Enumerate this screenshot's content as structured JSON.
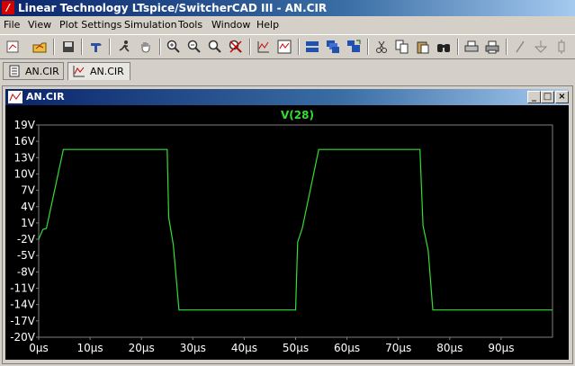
{
  "window": {
    "title": "Linear Technology LTspice/SwitcherCAD III - AN.CIR",
    "app_icon_letter": "/"
  },
  "menu": [
    "File",
    "View",
    "Plot Settings",
    "Simulation",
    "Tools",
    "Window",
    "Help"
  ],
  "toolbar": {
    "icons": [
      "open-schematic-icon",
      "new-schematic-icon",
      "save-icon",
      "hammer-icon",
      "run-icon",
      "hand-pan-icon",
      "zoom-in-icon",
      "zoom-out-icon",
      "zoom-fit-icon",
      "cancel-zoom-icon",
      "autorange-icon",
      "trace-icon",
      "tile-icon",
      "cascade-icon",
      "arrange-icon",
      "cut-icon",
      "copy-icon",
      "find-icon",
      "print-setup-icon",
      "print-icon",
      "draw-line-icon",
      "ground-icon",
      "resistor-icon"
    ]
  },
  "tabs": [
    {
      "label": "AN.CIR",
      "kind": "netlist",
      "active": false
    },
    {
      "label": "AN.CIR",
      "kind": "waveform",
      "active": true
    }
  ],
  "child_window": {
    "title": "AN.CIR",
    "buttons": {
      "minimize": "_",
      "maximize": "□",
      "close": "×"
    }
  },
  "colors": {
    "trace": "#33dd33",
    "plot_bg": "#000000",
    "axis_text": "#ffffff",
    "grid_frame": "#808080"
  },
  "chart_data": {
    "type": "line",
    "title": "V(28)",
    "xlabel": "",
    "ylabel": "",
    "x_ticks": [
      "0µs",
      "10µs",
      "20µs",
      "30µs",
      "40µs",
      "50µs",
      "60µs",
      "70µs",
      "80µs",
      "90µs"
    ],
    "y_ticks": [
      "19V",
      "16V",
      "13V",
      "10V",
      "7V",
      "4V",
      "1V",
      "-2V",
      "-5V",
      "-8V",
      "-11V",
      "-14V",
      "-17V",
      "-20V"
    ],
    "xlim": [
      0,
      100
    ],
    "ylim": [
      -20,
      19
    ],
    "grid": false,
    "series": [
      {
        "name": "V(28)",
        "x": [
          0,
          0.8,
          1.5,
          4.8,
          25.0,
          25.3,
          26.2,
          27.3,
          50.0,
          50.4,
          51.3,
          54.5,
          74.2,
          74.8,
          75.8,
          76.7,
          100
        ],
        "y": [
          -2.0,
          -0.2,
          0.0,
          14.5,
          14.5,
          2.0,
          -3.0,
          -15.0,
          -15.0,
          -2.5,
          0.0,
          14.5,
          14.5,
          0.5,
          -4.0,
          -15.0,
          -15.0
        ]
      }
    ]
  }
}
